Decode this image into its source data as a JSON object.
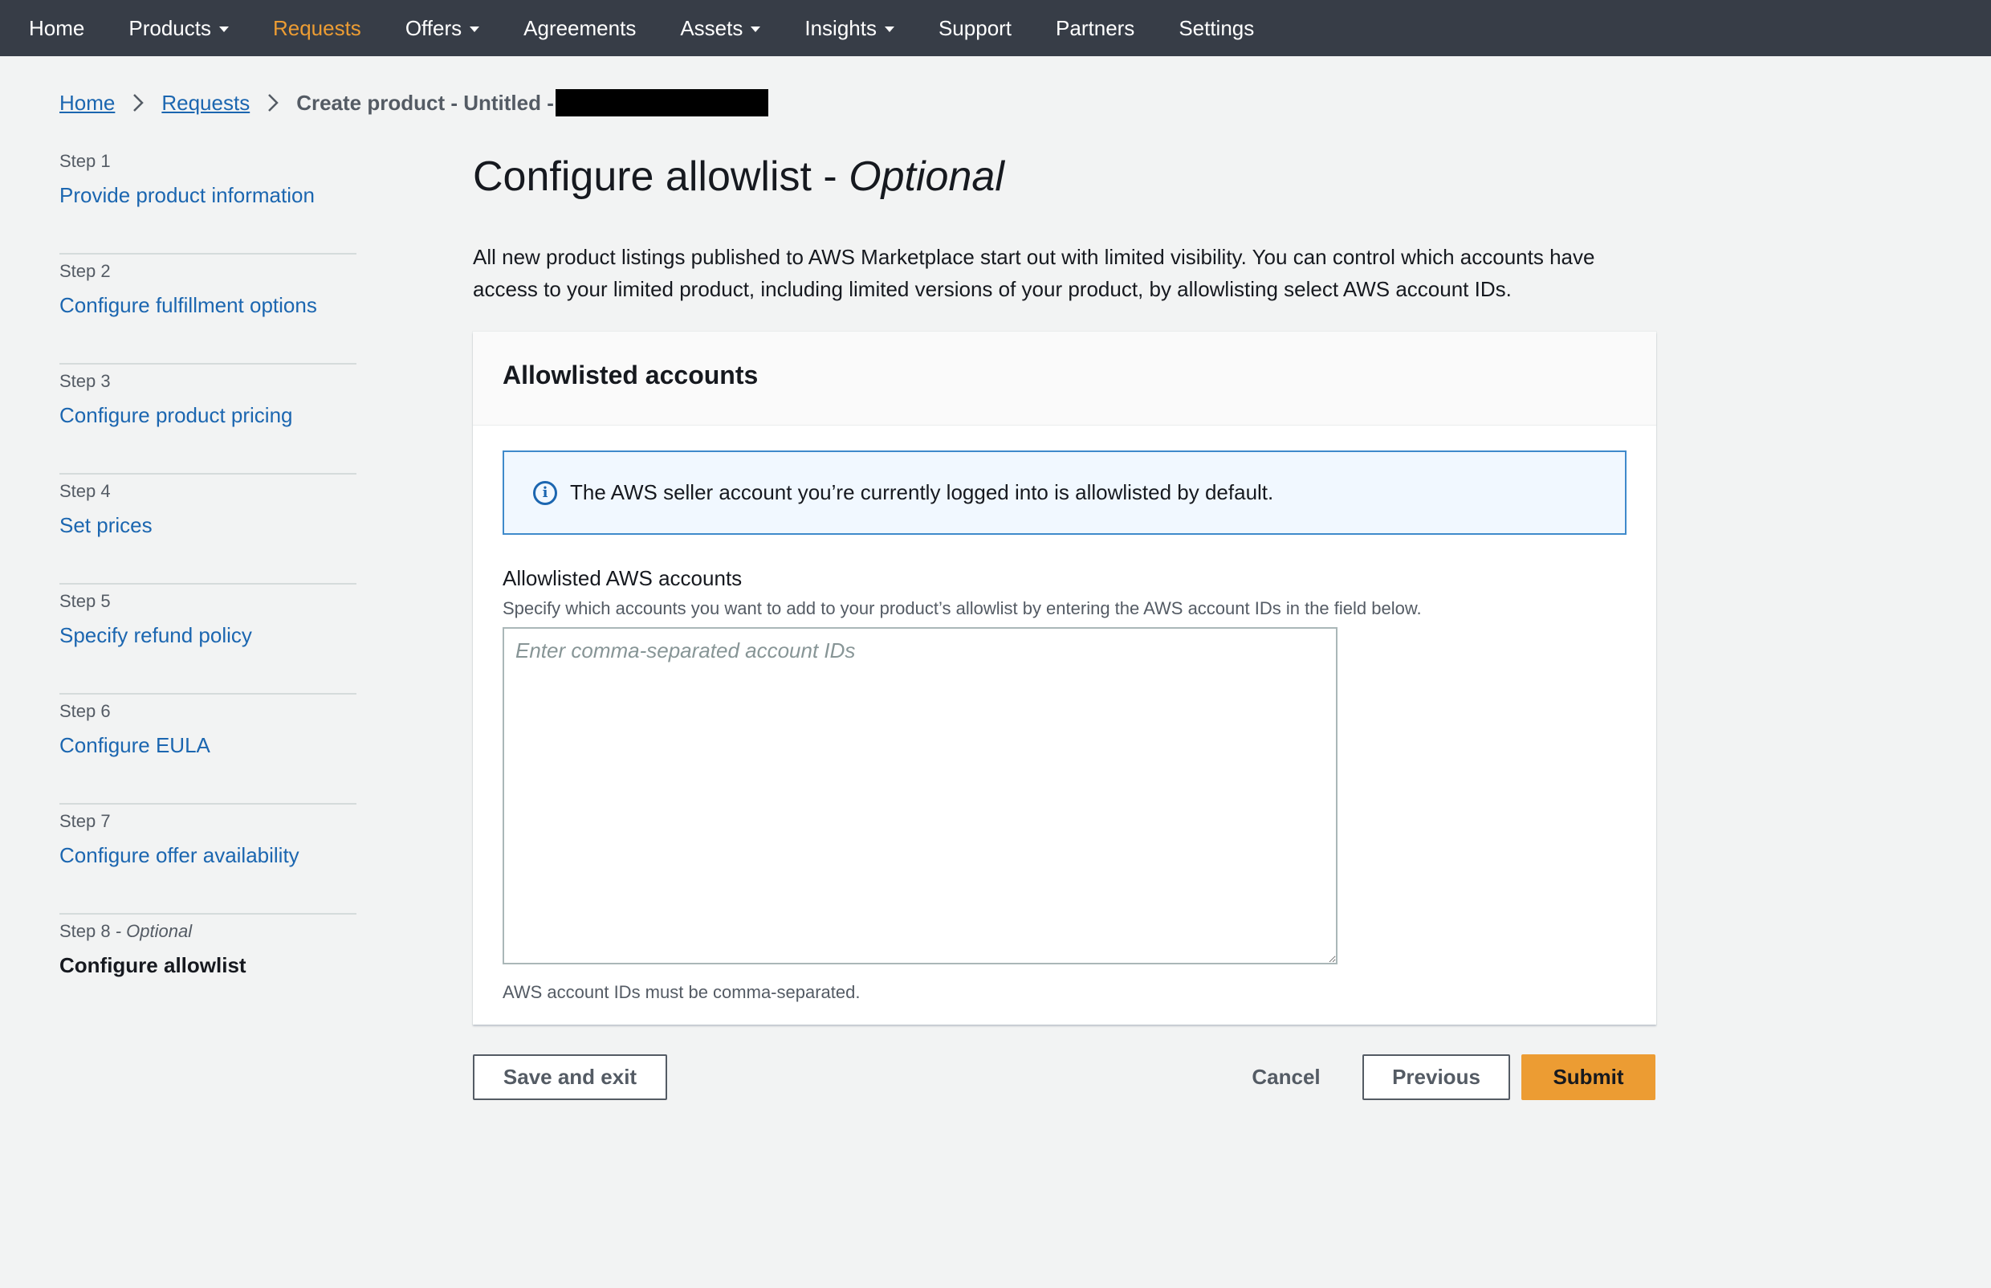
{
  "nav": {
    "items": [
      {
        "label": "Home",
        "dropdown": false,
        "active": false
      },
      {
        "label": "Products",
        "dropdown": true,
        "active": false
      },
      {
        "label": "Requests",
        "dropdown": false,
        "active": true
      },
      {
        "label": "Offers",
        "dropdown": true,
        "active": false
      },
      {
        "label": "Agreements",
        "dropdown": false,
        "active": false
      },
      {
        "label": "Assets",
        "dropdown": true,
        "active": false
      },
      {
        "label": "Insights",
        "dropdown": true,
        "active": false
      },
      {
        "label": "Support",
        "dropdown": false,
        "active": false
      },
      {
        "label": "Partners",
        "dropdown": false,
        "active": false
      },
      {
        "label": "Settings",
        "dropdown": false,
        "active": false
      }
    ],
    "active_color": "#ec9c33",
    "background": "#373d47"
  },
  "breadcrumb": {
    "home": "Home",
    "requests": "Requests",
    "current": "Create product - Untitled -"
  },
  "steps": [
    {
      "step": "Step 1",
      "optional": "",
      "label": "Provide product information",
      "current": false
    },
    {
      "step": "Step 2",
      "optional": "",
      "label": "Configure fulfillment options",
      "current": false
    },
    {
      "step": "Step 3",
      "optional": "",
      "label": "Configure product pricing",
      "current": false
    },
    {
      "step": "Step 4",
      "optional": "",
      "label": "Set prices",
      "current": false
    },
    {
      "step": "Step 5",
      "optional": "",
      "label": "Specify refund policy",
      "current": false
    },
    {
      "step": "Step 6",
      "optional": "",
      "label": "Configure EULA",
      "current": false
    },
    {
      "step": "Step 7",
      "optional": "",
      "label": "Configure offer availability",
      "current": false
    },
    {
      "step": "Step 8",
      "optional": " - Optional",
      "label": "Configure allowlist",
      "current": true
    }
  ],
  "page": {
    "title": "Configure allowlist - ",
    "title_optional": "Optional",
    "description": "All new product listings published to AWS Marketplace start out with limited visibility. You can control which accounts have access to your limited product, including limited versions of your product, by allowlisting select AWS account IDs."
  },
  "panel": {
    "title": "Allowlisted accounts",
    "info": "The AWS seller account you’re currently logged into is allowlisted by default.",
    "field_label": "Allowlisted AWS accounts",
    "field_description": "Specify which accounts you want to add to your product’s allowlist by entering the AWS account IDs in the field below.",
    "placeholder": "Enter comma-separated account IDs",
    "value": "",
    "hint": "AWS account IDs must be comma-separated."
  },
  "actions": {
    "save_exit": "Save and exit",
    "cancel": "Cancel",
    "previous": "Previous",
    "submit": "Submit"
  },
  "icons": {
    "info": "info-circle-icon",
    "breadcrumb_sep": "chevron-right-icon",
    "dropdown": "caret-down-icon"
  }
}
